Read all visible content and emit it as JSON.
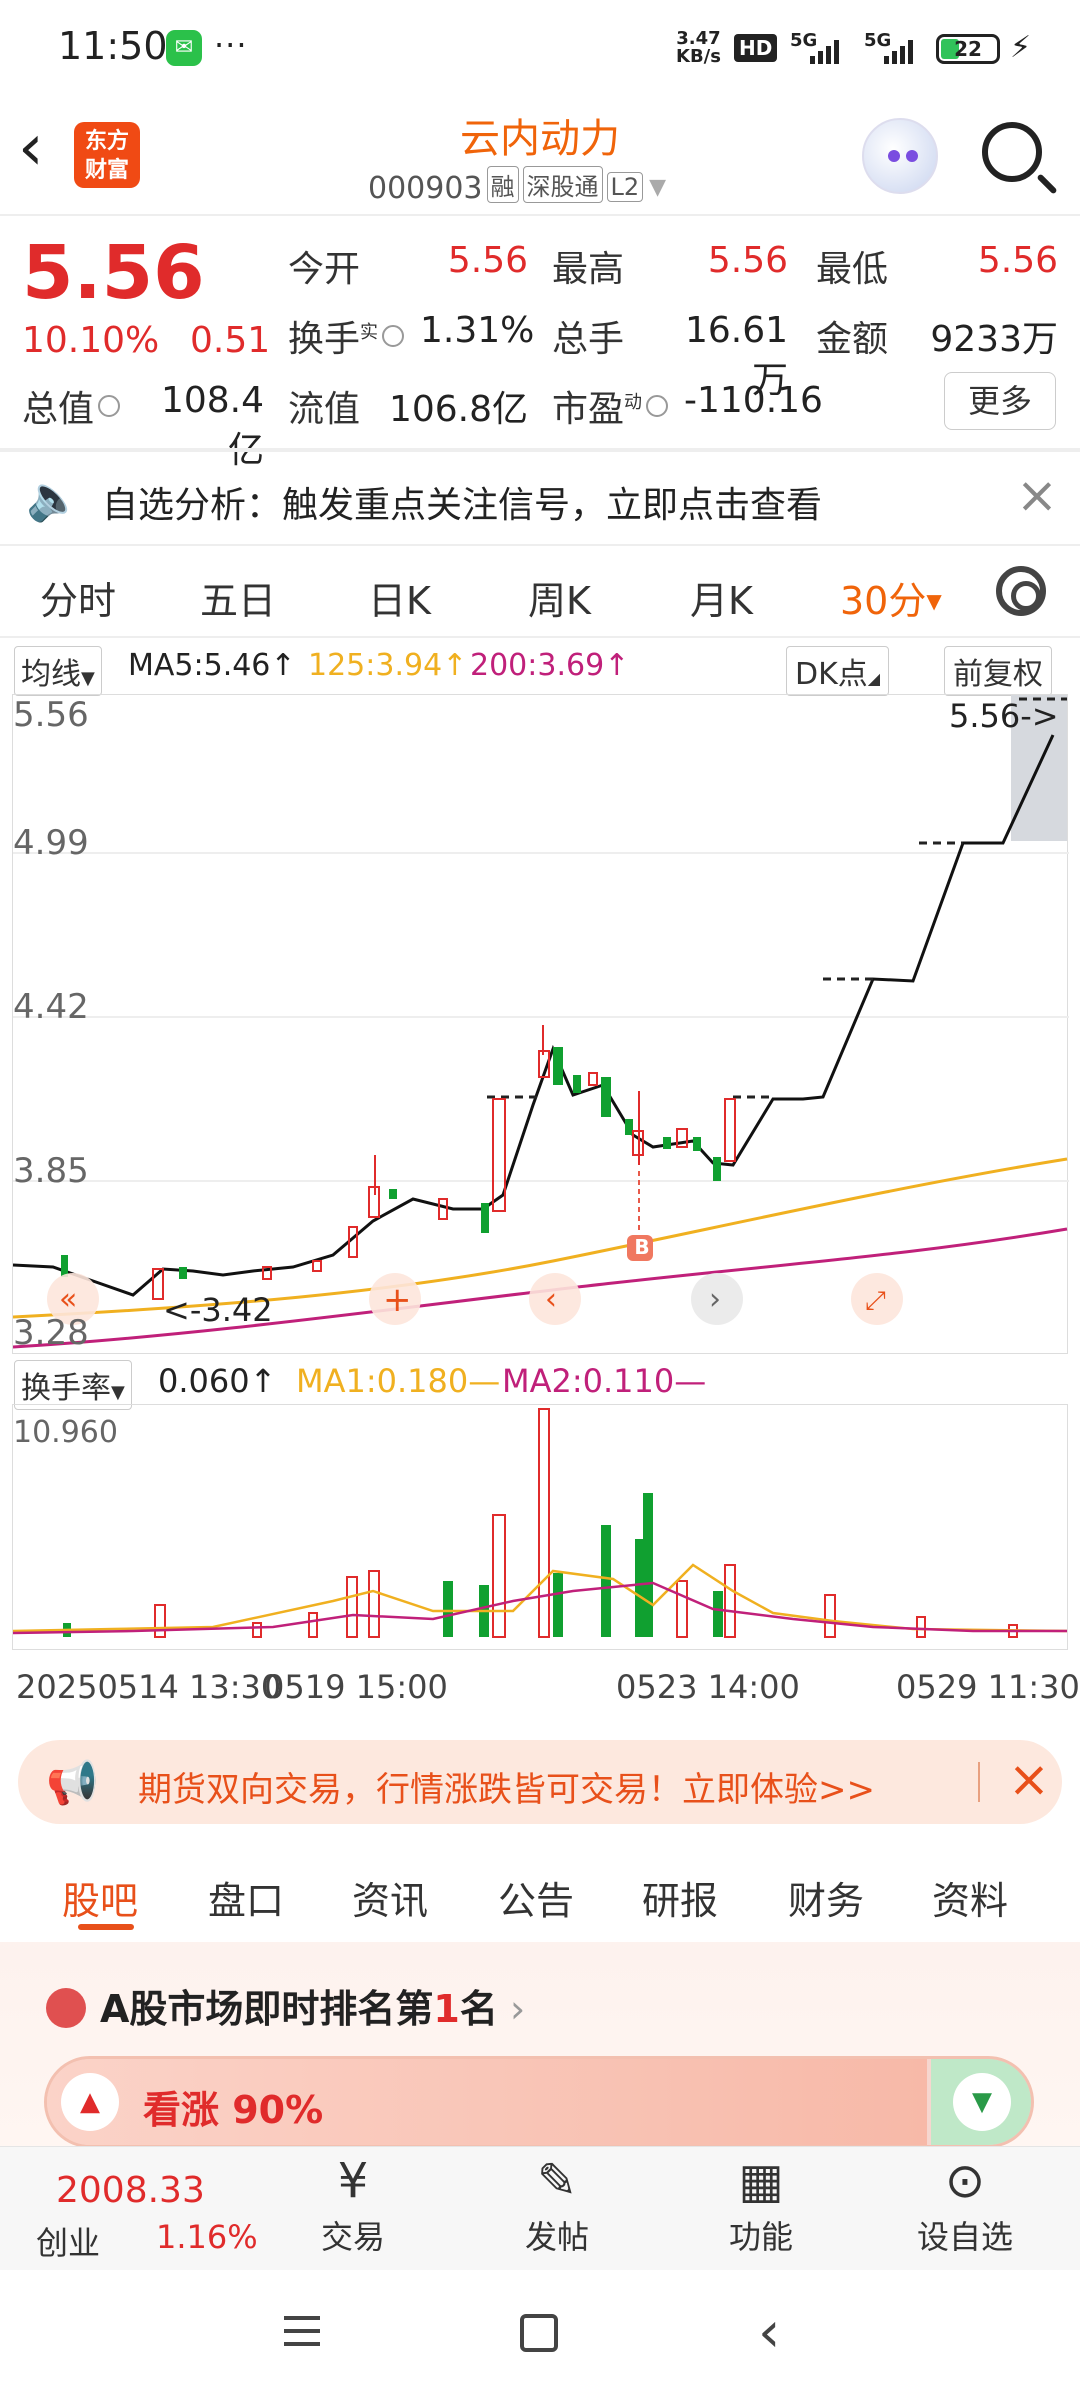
{
  "status_bar": {
    "time": "11:50",
    "more": "···",
    "net_speed_top": "3.47",
    "net_speed_bottom": "KB/s",
    "hd": "HD",
    "sig1": "5G",
    "sig2": "5G",
    "battery": "22"
  },
  "header": {
    "back_icon": "chevron-left-icon",
    "logo_line1": "东方",
    "logo_line2": "财富",
    "title": "云内动力",
    "code": "000903",
    "tag1": "融",
    "tag2": "深股通",
    "tag3": "L2"
  },
  "quote": {
    "price": "5.56",
    "change_pct": "10.10%",
    "change": "0.51",
    "open_label": "今开",
    "open": "5.56",
    "high_label": "最高",
    "high": "5.56",
    "low_label": "最低",
    "low": "5.56",
    "turnover_label": "换手",
    "turnover_sup": "实",
    "turnover": "1.31%",
    "volume_label": "总手",
    "volume": "16.61万",
    "amount_label": "金额",
    "amount": "9233万",
    "total_value_label": "总值",
    "total_value": "108.4亿",
    "float_value_label": "流值",
    "float_value": "106.8亿",
    "pe_label": "市盈",
    "pe_sup": "动",
    "pe": "-110.16",
    "more_button": "更多"
  },
  "notice": {
    "text": "自选分析：触发重点关注信号，立即点击查看"
  },
  "period_tabs": [
    "分时",
    "五日",
    "日K",
    "周K",
    "月K",
    "30分"
  ],
  "ma_row": {
    "selector": "均线",
    "ma5": "MA5:5.46↑",
    "ma125": "125:3.94↑",
    "ma200": "200:3.69↑",
    "dk": "DK点",
    "adjust": "前复权"
  },
  "chart_data": {
    "type": "line",
    "y_ticks": [
      "5.56",
      "4.99",
      "4.42",
      "3.85",
      "3.28"
    ],
    "price_marker": "5.56->",
    "low_marker": "<-3.42",
    "buy_marker": "B",
    "volume_indicator": {
      "selector": "换手率",
      "value": "0.060↑",
      "ma1": "MA1:0.180—",
      "ma2": "MA2:0.110—",
      "max_label": "10.960"
    },
    "x_labels": [
      "20250514 13:30",
      "0519 15:00",
      "0523 14:00",
      "0529 11:30"
    ]
  },
  "promo": {
    "text": "期货双向交易，行情涨跌皆可交易！立即体验>>"
  },
  "bottom_tabs": [
    "股吧",
    "盘口",
    "资讯",
    "公告",
    "研报",
    "财务",
    "资料"
  ],
  "ranking": {
    "prefix": "A股市场即时排名第",
    "rank": "1",
    "suffix": "名",
    "bull_text": "看涨 90%"
  },
  "toolbar": {
    "index_value": "2008.33",
    "index_name": "创业",
    "index_pct": "1.16%",
    "items": [
      {
        "label": "交易",
        "icon": "yen-icon"
      },
      {
        "label": "发帖",
        "icon": "edit-icon"
      },
      {
        "label": "功能",
        "icon": "grid-icon"
      },
      {
        "label": "设自选",
        "icon": "more-icon"
      }
    ]
  },
  "colors": {
    "accent": "#f0640a",
    "up": "#e02b2b",
    "down": "#10a030",
    "ma125": "#f0b020",
    "ma200": "#c0207a"
  }
}
